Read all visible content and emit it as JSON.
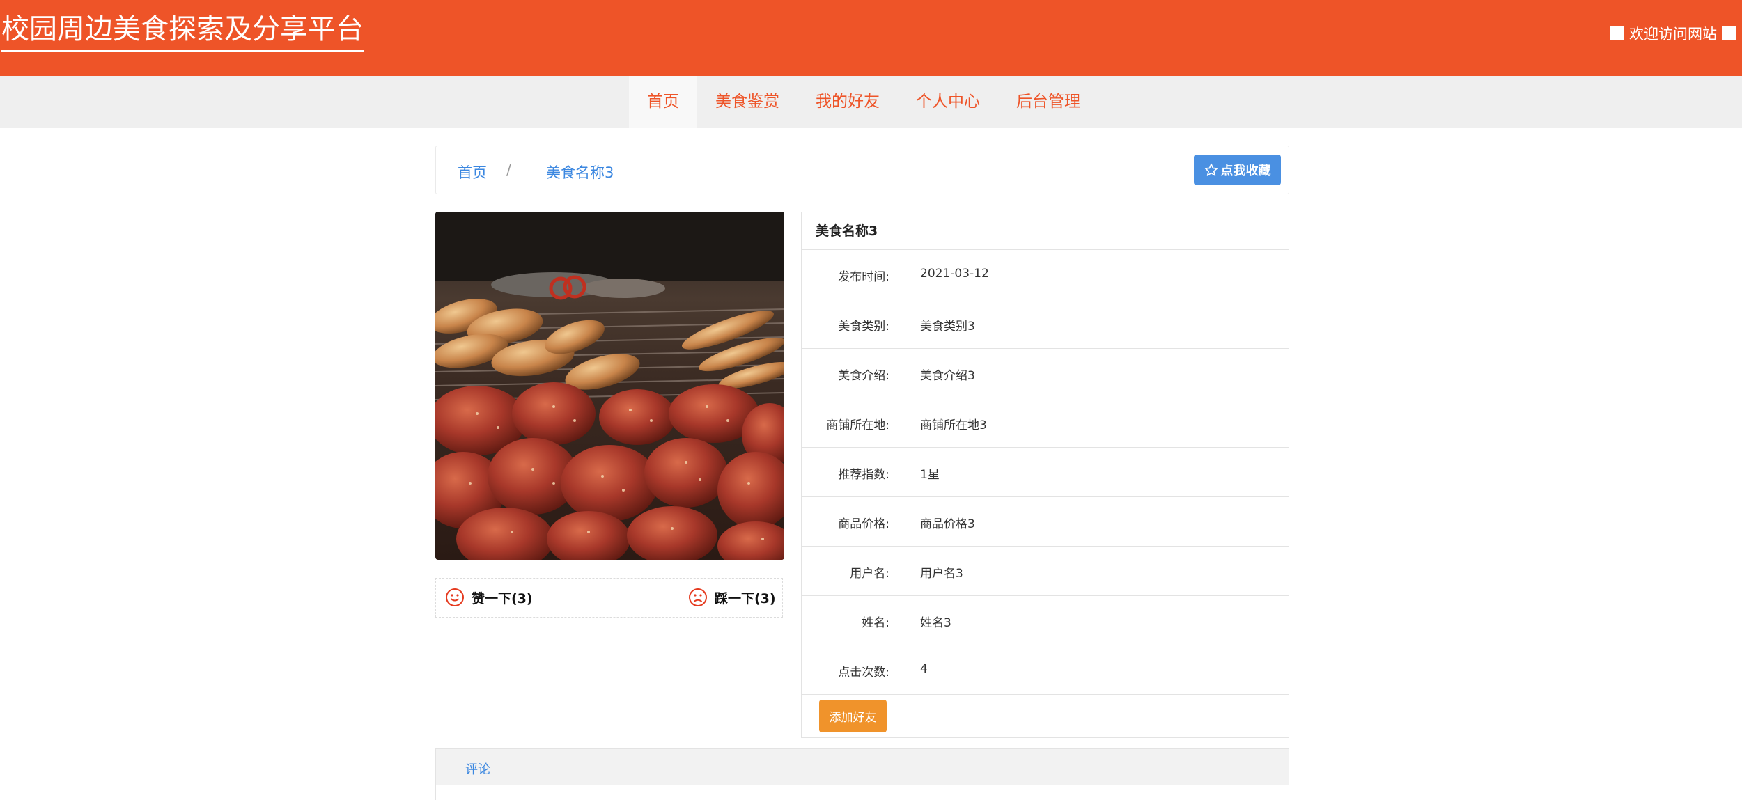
{
  "header": {
    "site_title": "校园周边美食探索及分享平台",
    "welcome": "欢迎访问网站"
  },
  "nav": [
    {
      "label": "首页",
      "active": true
    },
    {
      "label": "美食鉴赏"
    },
    {
      "label": "我的好友"
    },
    {
      "label": "个人中心"
    },
    {
      "label": "后台管理"
    }
  ],
  "breadcrumb": {
    "home": "首页",
    "separator": "/",
    "current": "美食名称3",
    "favorite_button": "点我收藏"
  },
  "votes": {
    "like_label": "赞一下(3)",
    "dislike_label": "踩一下(3)"
  },
  "detail": {
    "title": "美食名称3",
    "rows": [
      {
        "label": "发布时间:",
        "value": "2021-03-12"
      },
      {
        "label": "美食类别:",
        "value": "美食类别3"
      },
      {
        "label": "美食介绍:",
        "value": "美食介绍3"
      },
      {
        "label": "商铺所在地:",
        "value": "商铺所在地3"
      },
      {
        "label": "推荐指数:",
        "value": "1星"
      },
      {
        "label": "商品价格:",
        "value": "商品价格3"
      },
      {
        "label": "用户名:",
        "value": "用户名3"
      },
      {
        "label": "姓名:",
        "value": "姓名3"
      },
      {
        "label": "点击次数:",
        "value": "4"
      }
    ],
    "add_friend_button": "添加好友"
  },
  "comments": {
    "tab_label": "评论"
  },
  "colors": {
    "brand": "#ee5428",
    "link": "#3b87e0",
    "button_blue": "#4a90e2",
    "button_orange": "#f0932b"
  }
}
